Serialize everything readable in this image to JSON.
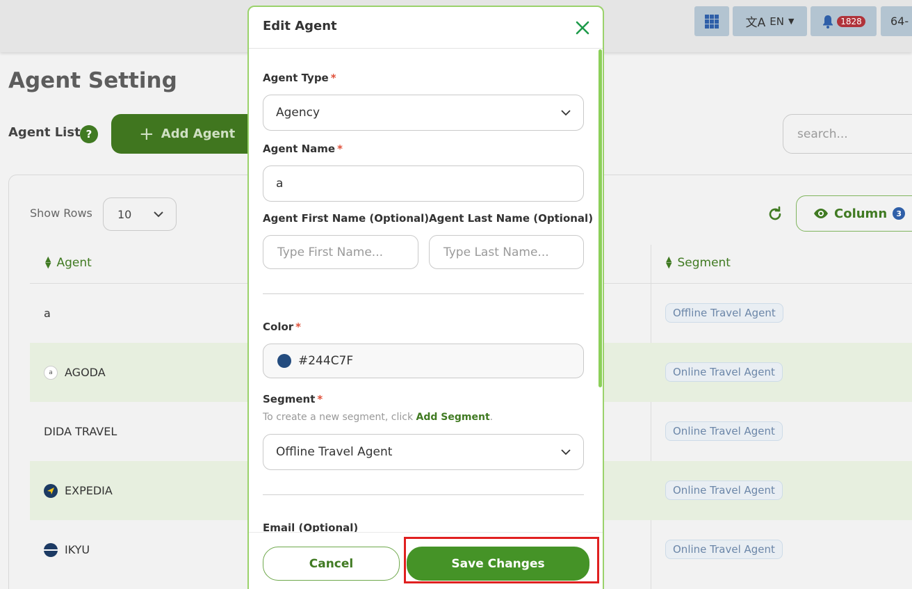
{
  "topbar": {
    "language": "EN",
    "notification_count": "1828",
    "user_text": "64-"
  },
  "page": {
    "title": "Agent Setting",
    "list_label": "Agent List",
    "help_label": "?",
    "add_agent_label": "Add Agent",
    "search_placeholder": "search..."
  },
  "table": {
    "show_rows_label": "Show Rows",
    "rows_value": "10",
    "column_button_label": "Column",
    "column_count": "3",
    "headers": {
      "agent": "Agent",
      "segment": "Segment"
    },
    "rows": [
      {
        "agent": "a",
        "segment": "Offline Travel Agent",
        "logo": ""
      },
      {
        "agent": "AGODA",
        "segment": "Online Travel Agent",
        "logo": "agoda-logo"
      },
      {
        "agent": "DIDA TRAVEL",
        "segment": "Online Travel Agent",
        "logo": ""
      },
      {
        "agent": "EXPEDIA",
        "segment": "Online Travel Agent",
        "logo": "expedia-logo"
      },
      {
        "agent": "IKYU",
        "segment": "Online Travel Agent",
        "logo": "ikyu-logo"
      }
    ]
  },
  "modal": {
    "title": "Edit Agent",
    "agent_type": {
      "label": "Agent Type",
      "required": "*",
      "value": "Agency"
    },
    "agent_name": {
      "label": "Agent Name",
      "required": "*",
      "value": "a"
    },
    "first_name": {
      "label": "Agent First Name (Optional)",
      "placeholder": "Type First Name..."
    },
    "last_name": {
      "label": "Agent Last Name (Optional)",
      "placeholder": "Type Last Name..."
    },
    "color": {
      "label": "Color",
      "required": "*",
      "value": "#244C7F"
    },
    "segment": {
      "label": "Segment",
      "required": "*",
      "hint_prefix": "To create a new segment, click ",
      "hint_link": "Add Segment",
      "hint_suffix": ".",
      "value": "Offline Travel Agent"
    },
    "email": {
      "label": "Email (Optional)"
    },
    "cancel_label": "Cancel",
    "save_label": "Save Changes"
  },
  "colors": {
    "accent_green": "#407a22",
    "save_green": "#459327",
    "agent_color": "#244C7F",
    "highlight_red": "#e02020"
  }
}
